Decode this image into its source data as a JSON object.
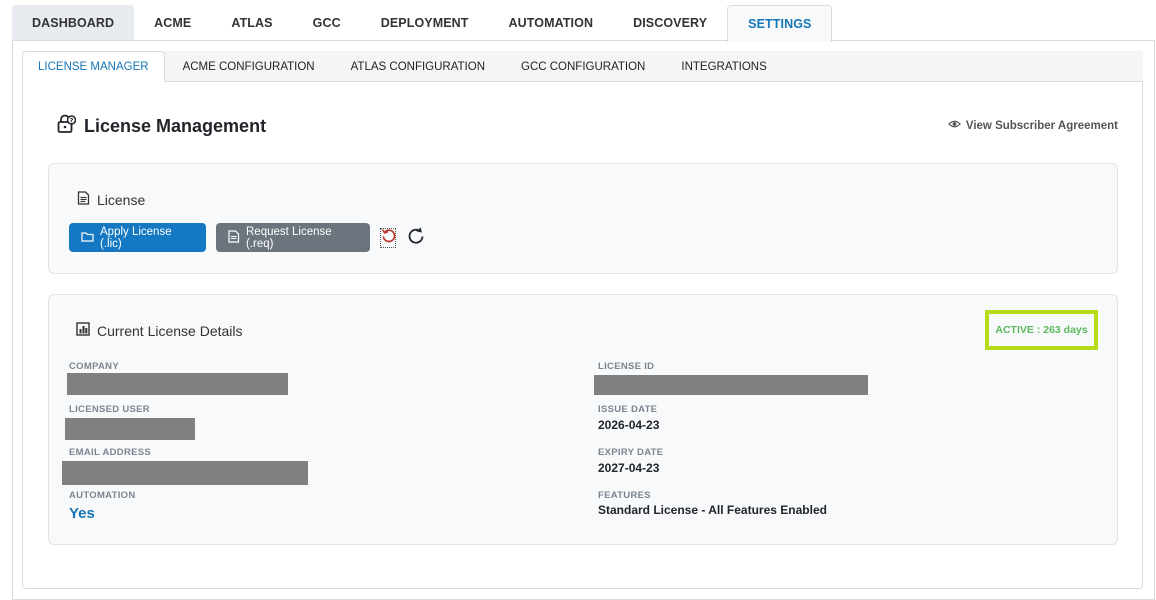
{
  "top_tabs": [
    {
      "label": "DASHBOARD"
    },
    {
      "label": "ACME"
    },
    {
      "label": "ATLAS"
    },
    {
      "label": "GCC"
    },
    {
      "label": "DEPLOYMENT"
    },
    {
      "label": "AUTOMATION"
    },
    {
      "label": "DISCOVERY"
    },
    {
      "label": "SETTINGS",
      "active": true
    }
  ],
  "sub_tabs": [
    {
      "label": "LICENSE MANAGER",
      "active": true
    },
    {
      "label": "ACME CONFIGURATION"
    },
    {
      "label": "ATLAS CONFIGURATION"
    },
    {
      "label": "GCC CONFIGURATION"
    },
    {
      "label": "INTEGRATIONS"
    }
  ],
  "page": {
    "title": "License Management",
    "title_icon": "lock-question-icon",
    "view_agreement_label": "View Subscriber Agreement",
    "view_agreement_icon": "eye-icon"
  },
  "license_card": {
    "title": "License",
    "title_icon": "file-text-icon",
    "apply_label": "Apply License (.lic)",
    "apply_icon": "folder-icon",
    "request_label": "Request License (.req)",
    "request_icon": "file-request-icon"
  },
  "details_card": {
    "title": "Current License Details",
    "title_icon": "bar-chart-icon",
    "status_text": "ACTIVE : 263 days",
    "status_color": "#5cb85c",
    "highlight_color": "#b6dc19",
    "fields_left": {
      "company_label": "COMPANY",
      "licensed_user_label": "LICENSED USER",
      "email_label": "EMAIL ADDRESS",
      "automation_label": "AUTOMATION",
      "automation_value": "Yes"
    },
    "fields_right": {
      "license_id_label": "LICENSE ID",
      "issue_date_label": "ISSUE DATE",
      "issue_date_value": "2026-04-23",
      "expiry_date_label": "EXPIRY DATE",
      "expiry_date_value": "2027-04-23",
      "features_label": "FEATURES",
      "features_value": "Standard License - All Features Enabled"
    }
  },
  "colors": {
    "accent": "#1576b6",
    "primary_button": "#1478c2",
    "secondary_button": "#6c757d"
  }
}
